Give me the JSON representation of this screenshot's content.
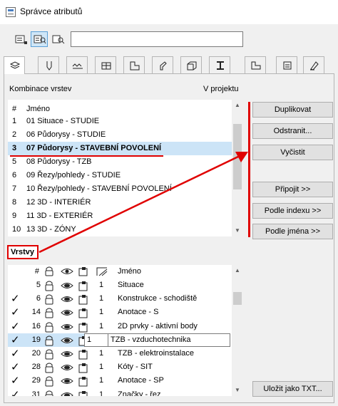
{
  "window": {
    "title": "Správce atributů"
  },
  "toolbar": {
    "buttons": [
      {
        "icon": "list-view-icon",
        "active": false
      },
      {
        "icon": "list-search-view-icon",
        "active": true
      },
      {
        "icon": "search-view-icon",
        "active": false
      }
    ],
    "search_value": ""
  },
  "tabs": [
    {
      "icon": "layers-icon",
      "active": true
    },
    {
      "icon": "pen-icon"
    },
    {
      "icon": "line-type-icon"
    },
    {
      "icon": "hatch-icon"
    },
    {
      "icon": "surface-icon"
    },
    {
      "icon": "building-material-icon"
    },
    {
      "icon": "composite-icon"
    },
    {
      "icon": "profile-icon"
    },
    {
      "icon": "zone-category-icon"
    },
    {
      "icon": "markup-style-icon"
    },
    {
      "icon": "operation-profile-icon"
    },
    {
      "icon": "mep-system-icon"
    }
  ],
  "combinations": {
    "label": "Kombinace vrstev",
    "right_label": "V projektu",
    "header": {
      "num": "#",
      "name": "Jméno"
    },
    "rows": [
      {
        "num": "1",
        "name": "01 Situace - STUDIE"
      },
      {
        "num": "2",
        "name": "06 Půdorysy - STUDIE"
      },
      {
        "num": "3",
        "name": "07 Půdorysy - STAVEBNÍ POVOLENÍ",
        "selected": true
      },
      {
        "num": "5",
        "name": "08 Půdorysy - TZB"
      },
      {
        "num": "6",
        "name": "09 Řezy/pohledy - STUDIE"
      },
      {
        "num": "7",
        "name": "10 Řezy/pohledy - STAVEBNÍ POVOLENÍ"
      },
      {
        "num": "8",
        "name": "12 3D - INTERIÉR"
      },
      {
        "num": "9",
        "name": "11 3D - EXTERIÉR"
      },
      {
        "num": "10",
        "name": "13 3D - ZÓNY"
      }
    ]
  },
  "buttons": {
    "duplicate": "Duplikovat",
    "delete": "Odstranit...",
    "purge": "Vyčistit",
    "append": "Připojit >>",
    "by_index": "Podle indexu >>",
    "by_name": "Podle jména >>",
    "save_txt": "Uložit jako TXT..."
  },
  "layers": {
    "label": "Vrstvy",
    "header": {
      "num": "#",
      "name": "Jméno"
    },
    "rows": [
      {
        "checked": false,
        "num": "5",
        "pen": "1",
        "name": "Situace"
      },
      {
        "checked": true,
        "num": "6",
        "pen": "1",
        "name": "Konstrukce - schodiště"
      },
      {
        "checked": true,
        "num": "14",
        "pen": "1",
        "name": "Anotace - S"
      },
      {
        "checked": true,
        "num": "16",
        "pen": "1",
        "name": "2D prvky - aktivní body"
      },
      {
        "checked": true,
        "num": "19",
        "pen": "1",
        "name": "TZB - vzduchotechnika",
        "editing": true
      },
      {
        "checked": true,
        "num": "20",
        "pen": "1",
        "name": "TZB - elektroinstalace"
      },
      {
        "checked": true,
        "num": "28",
        "pen": "1",
        "name": "Kóty - SIT"
      },
      {
        "checked": true,
        "num": "29",
        "pen": "1",
        "name": "Anotace - SP"
      },
      {
        "checked": true,
        "num": "31",
        "pen": "1",
        "name": "Značky - řez"
      }
    ]
  },
  "colors": {
    "accent": "#e00000",
    "selection": "#cce4f7",
    "active_border": "#5a9fd6"
  }
}
